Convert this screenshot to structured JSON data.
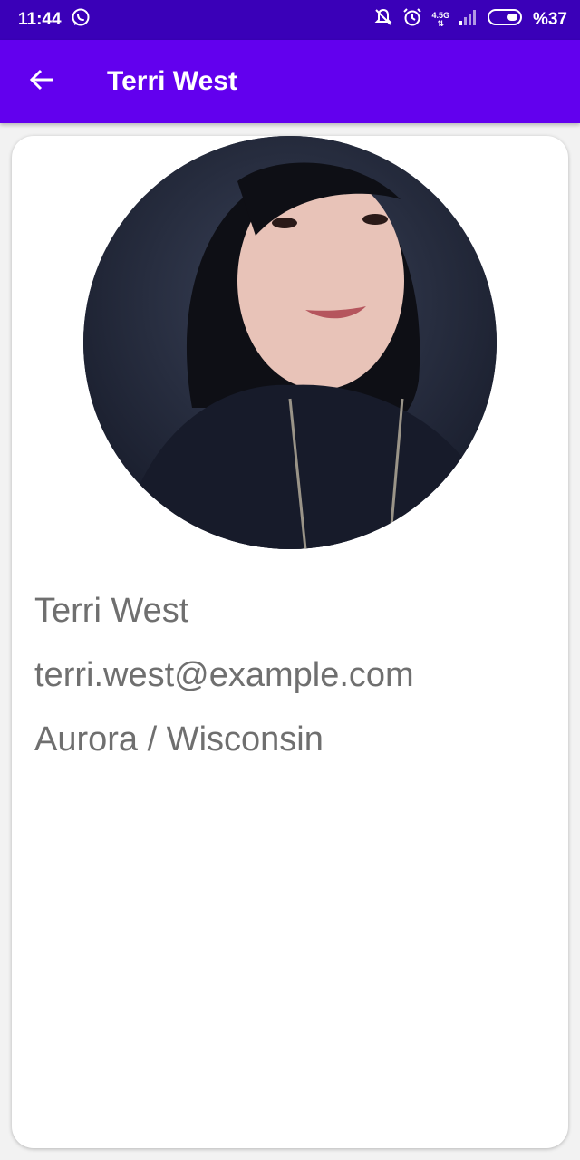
{
  "status_bar": {
    "time": "11:44",
    "network": "4.5G",
    "battery": "%37",
    "icons": [
      "whatsapp-icon",
      "mute-vibrate-icon",
      "alarm-icon",
      "signal-icon",
      "battery-icon"
    ]
  },
  "app_bar": {
    "title": "Terri West",
    "back_icon": "arrow-back-icon"
  },
  "profile": {
    "name": "Terri West",
    "email": "terri.west@example.com",
    "location": "Aurora / Wisconsin"
  },
  "colors": {
    "status_bar": "#3a00b8",
    "app_bar": "#6200ee",
    "text_secondary": "#6f6f6f",
    "card": "#ffffff"
  }
}
